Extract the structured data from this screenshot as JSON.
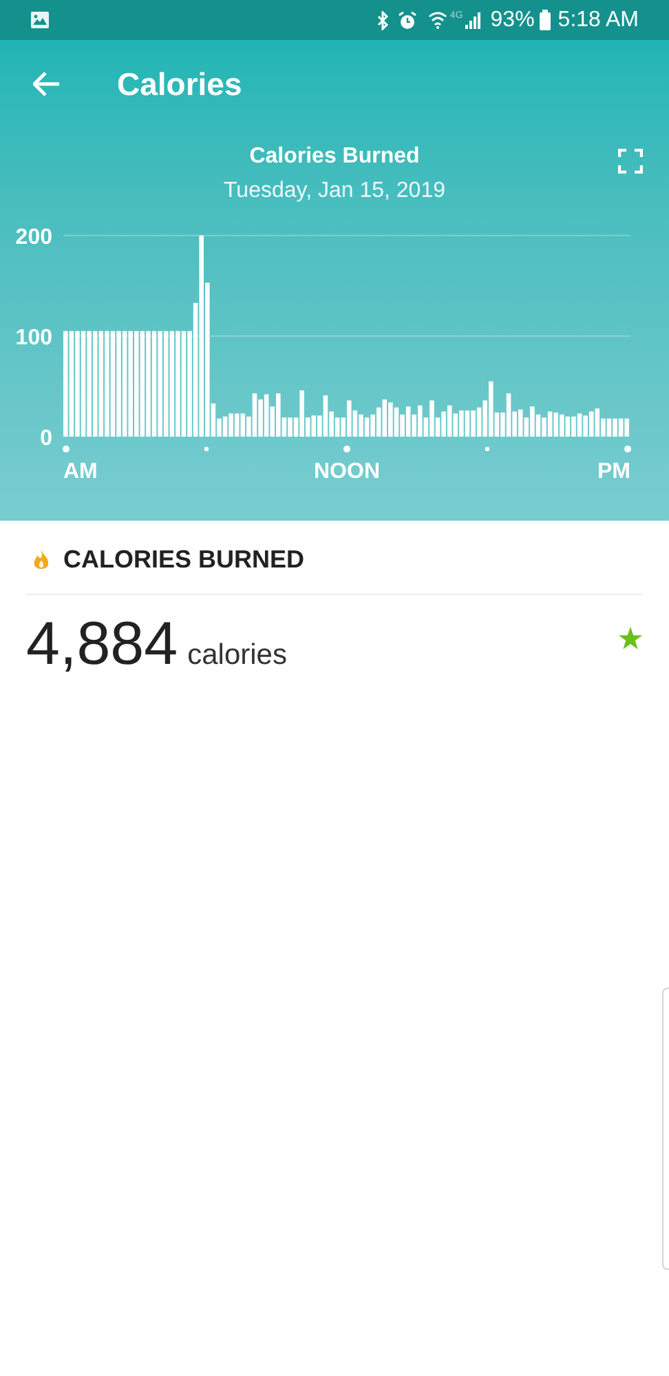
{
  "status_bar": {
    "network": "4G",
    "battery": "93%",
    "time": "5:18 AM"
  },
  "app_bar": {
    "title": "Calories"
  },
  "chart_header": {
    "title": "Calories Burned",
    "date": "Tuesday, Jan 15, 2019"
  },
  "x_axis_labels": [
    "AM",
    "NOON",
    "PM"
  ],
  "chart_data": {
    "type": "bar",
    "ylim": [
      0,
      200
    ],
    "yticks": [
      0,
      100,
      200
    ],
    "values": [
      105,
      105,
      105,
      105,
      105,
      105,
      105,
      105,
      105,
      105,
      105,
      105,
      105,
      105,
      105,
      105,
      105,
      105,
      105,
      105,
      105,
      105,
      133,
      200,
      153,
      33,
      18,
      20,
      23,
      23,
      23,
      20,
      43,
      37,
      42,
      30,
      43,
      19,
      19,
      19,
      46,
      19,
      21,
      21,
      41,
      25,
      19,
      19,
      36,
      26,
      22,
      19,
      22,
      29,
      37,
      34,
      29,
      22,
      30,
      22,
      31,
      19,
      36,
      19,
      25,
      31,
      23,
      26,
      26,
      26,
      29,
      36,
      55,
      24,
      24,
      43,
      25,
      27,
      19,
      30,
      22,
      19,
      25,
      24,
      22,
      20,
      20,
      23,
      21,
      25,
      28,
      18,
      18,
      18,
      18,
      18
    ]
  },
  "summary": {
    "heading": "CALORIES BURNED",
    "value": "4,884",
    "unit": "calories",
    "goal_met": true
  }
}
